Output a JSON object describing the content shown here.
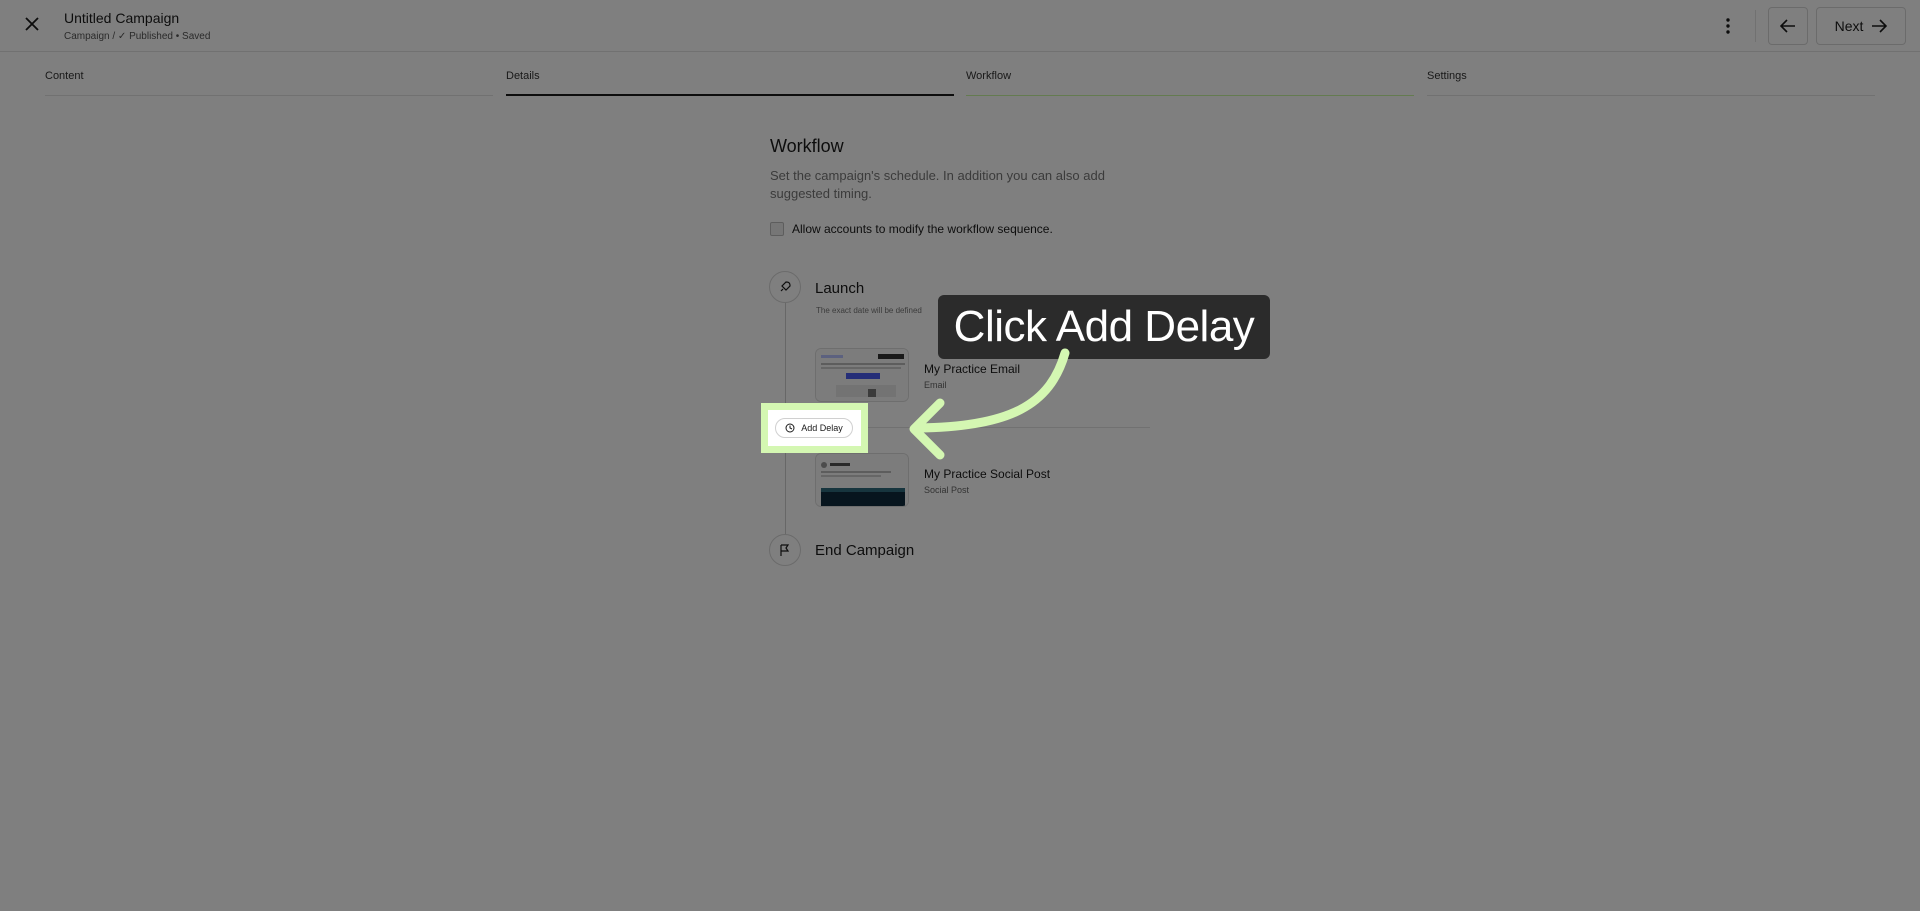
{
  "header": {
    "title": "Untitled Campaign",
    "breadcrumb": "Campaign / ✓ Published • Saved",
    "next_label": "Next"
  },
  "tabs": [
    {
      "label": "Content"
    },
    {
      "label": "Details"
    },
    {
      "label": "Workflow"
    },
    {
      "label": "Settings"
    }
  ],
  "workflow": {
    "title": "Workflow",
    "description": "Set the campaign's schedule. In addition you can also add suggested timing.",
    "checkbox_label": "Allow accounts to modify the workflow sequence.",
    "launch_label": "Launch",
    "launch_note": "The exact date will be defined",
    "items": [
      {
        "title": "My Practice Email",
        "type": "Email"
      },
      {
        "title": "My Practice Social Post",
        "type": "Social Post"
      }
    ],
    "add_delay_label": "Add Delay",
    "end_label": "End Campaign"
  },
  "tutorial": {
    "tooltip": "Click Add Delay",
    "highlight_color": "#d4f7b2"
  }
}
